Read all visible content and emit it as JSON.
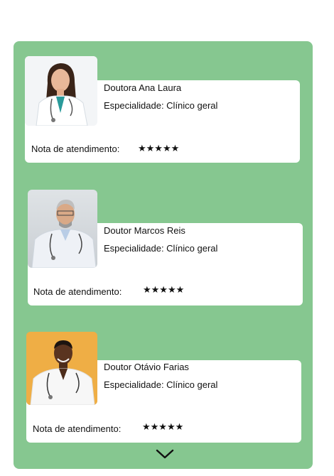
{
  "doctors": [
    {
      "name": "Doutora Ana Laura",
      "specialty": "Especialidade: Clínico geral",
      "rating_label": "Nota de atendimento:",
      "stars": "★★★★★"
    },
    {
      "name": "Doutor Marcos Reis",
      "specialty": "Especialidade: Clínico geral",
      "rating_label": "Nota de atendimento:",
      "stars": "★★★★★"
    },
    {
      "name": "Doutor Otávio Farias",
      "specialty": "Especialidade: Clínico geral",
      "rating_label": "Nota de atendimento:",
      "stars": "★★★★★"
    }
  ],
  "colors": {
    "panel": "#86c790",
    "card": "#ffffff",
    "photo3_bg": "#efae45"
  },
  "icons": {
    "scroll_more": "chevron-down-icon"
  }
}
